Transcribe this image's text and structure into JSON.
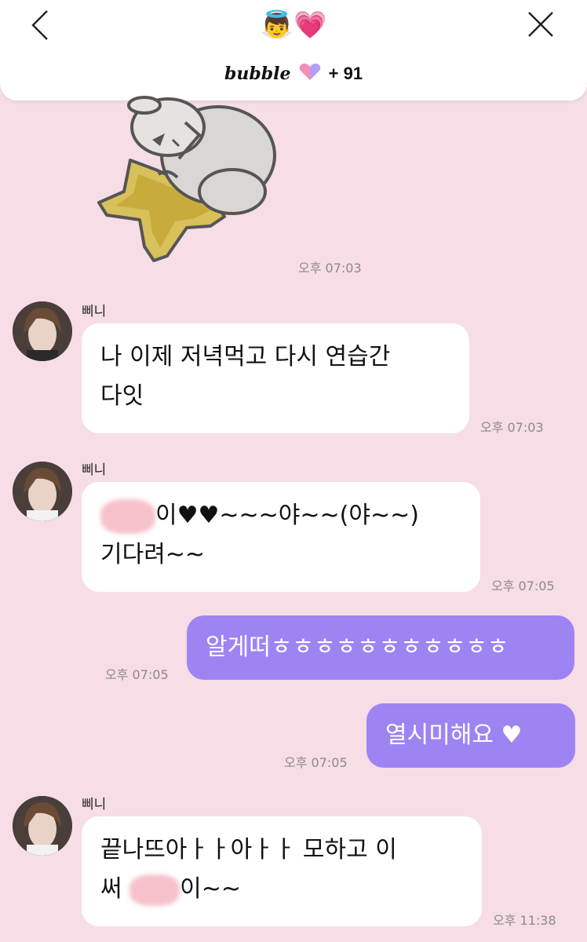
{
  "header": {
    "title_emoji": "👼💗",
    "brand": "bubble",
    "count": "+ 91"
  },
  "messages": [
    {
      "type": "sticker",
      "time": "오후 07:03"
    },
    {
      "type": "incoming",
      "sender": "삐니",
      "lines": [
        "나 이제 저녁먹고 다시 연습간",
        "다잇"
      ],
      "time": "오후 07:03"
    },
    {
      "type": "incoming",
      "sender": "삐니",
      "line1_after_blur": "이♥♥~~~야~~(야~~)",
      "line2": "기다려~~",
      "time": "오후 07:05"
    },
    {
      "type": "outgoing",
      "text": "알게떠ㅎㅎㅎㅎㅎㅎㅎㅎㅎㅎㅎ",
      "time": "오후 07:05"
    },
    {
      "type": "outgoing",
      "text": "열시미해요 ♥",
      "time": "오후 07:05"
    },
    {
      "type": "incoming",
      "sender": "삐니",
      "line1": "끝나뜨아ㅏㅏ아ㅏㅏ 모하고 이",
      "line2_before_blur": "써",
      "line2_after_blur": "이~~",
      "time": "오후 11:38"
    }
  ],
  "colors": {
    "background": "#f6dde6",
    "outgoing_bubble": "#9e84f2",
    "incoming_bubble": "#ffffff",
    "timestamp": "#8e8890"
  },
  "icons": [
    "back-chevron-icon",
    "close-x-icon",
    "bubble-heart-icon",
    "bear-star-sticker",
    "profile-avatar"
  ]
}
